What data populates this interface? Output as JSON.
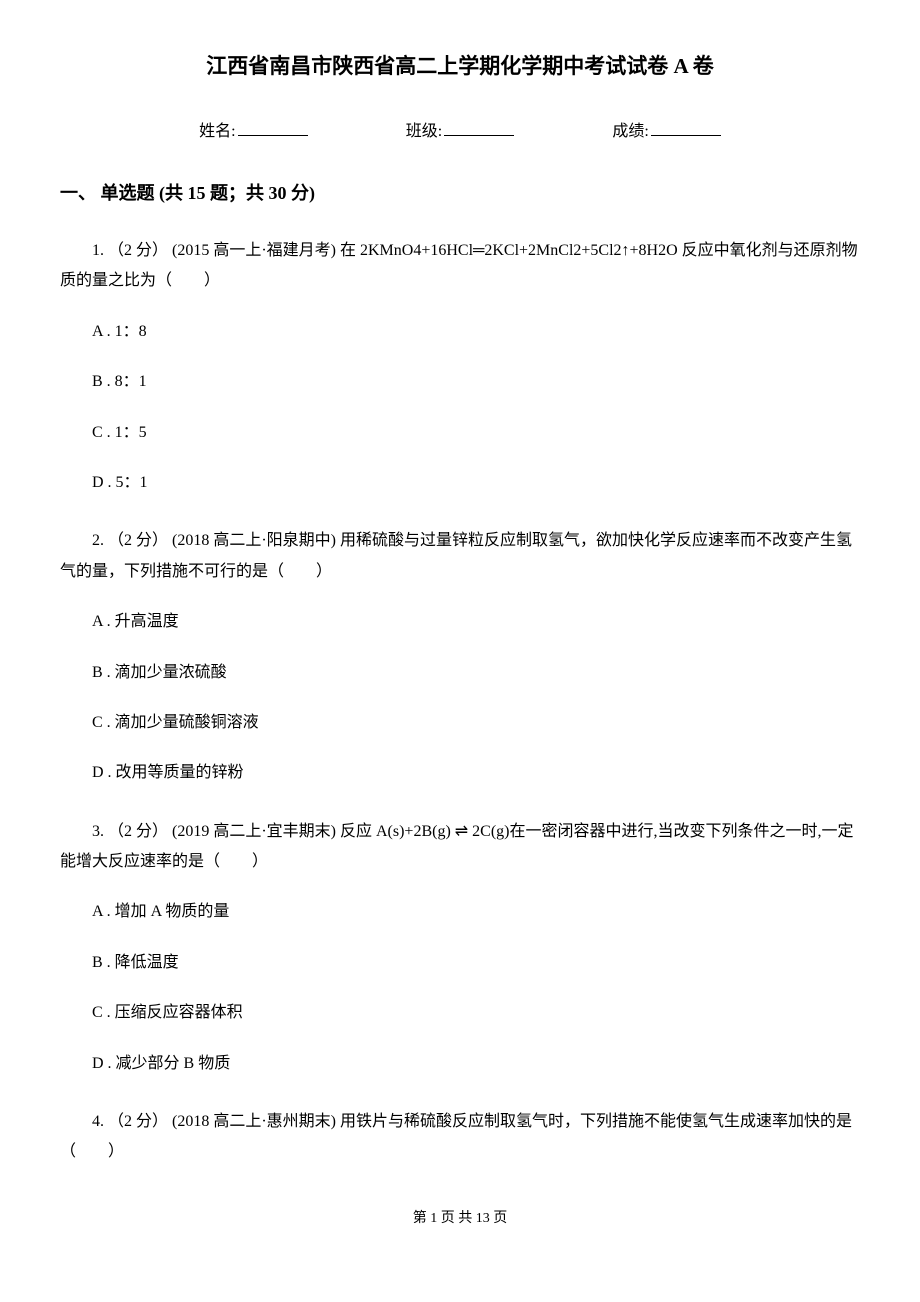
{
  "title": "江西省南昌市陕西省高二上学期化学期中考试试卷 A 卷",
  "info": {
    "name_label": "姓名:",
    "class_label": "班级:",
    "score_label": "成绩:"
  },
  "section": {
    "header": "一、 单选题 (共 15 题；共 30 分)"
  },
  "questions": [
    {
      "text": "1. （2 分） (2015 高一上·福建月考) 在 2KMnO4+16HCl═2KCl+2MnCl2+5Cl2↑+8H2O 反应中氧化剂与还原剂物质的量之比为（　　）",
      "options": [
        "A . 1：8",
        "B . 8：1",
        "C . 1：5",
        "D . 5：1"
      ]
    },
    {
      "text": "2. （2 分） (2018 高二上·阳泉期中) 用稀硫酸与过量锌粒反应制取氢气，欲加快化学反应速率而不改变产生氢气的量，下列措施不可行的是（　　）",
      "options": [
        "A . 升高温度",
        "B . 滴加少量浓硫酸",
        "C . 滴加少量硫酸铜溶液",
        "D . 改用等质量的锌粉"
      ]
    },
    {
      "text": "3.  （2 分）  (2019 高二上·宜丰期末)  反应 A(s)+2B(g)  ⇌ 2C(g)在一密闭容器中进行,当改变下列条件之一时,一定能增大反应速率的是（　　）",
      "options": [
        "A . 增加 A 物质的量",
        "B . 降低温度",
        "C . 压缩反应容器体积",
        "D . 减少部分 B 物质"
      ]
    },
    {
      "text": "4. （2 分） (2018 高二上·惠州期末) 用铁片与稀硫酸反应制取氢气时，下列措施不能使氢气生成速率加快的是（　　）",
      "options": []
    }
  ],
  "footer": "第 1 页 共 13 页"
}
